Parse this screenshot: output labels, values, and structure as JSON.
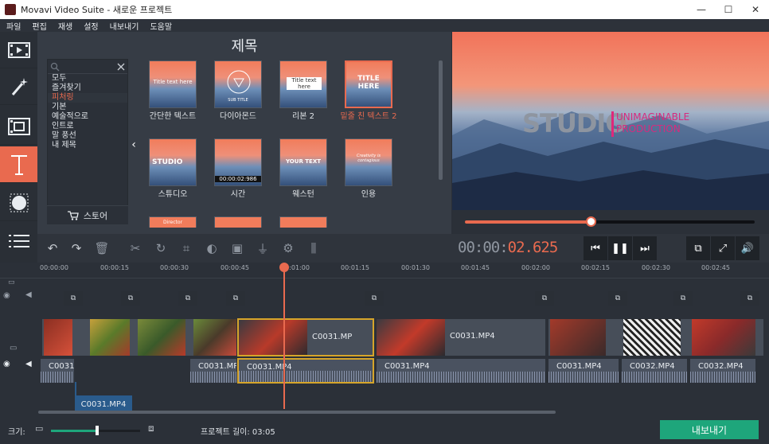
{
  "window": {
    "title": "Movavi Video Suite - 새로운 프로젝트",
    "minimize": "—",
    "maximize": "☐",
    "close": "✕"
  },
  "menu": [
    "파일",
    "편집",
    "재생",
    "설정",
    "내보내기",
    "도움말"
  ],
  "panel": {
    "title": "제목",
    "categories": [
      "모두",
      "즐겨찾기",
      "피처링",
      "기본",
      "예술적으로",
      "인트로",
      "말 풍선",
      "내 제목"
    ],
    "selected_category": "피처링",
    "store_label": "스토어",
    "tiles": [
      {
        "label": "간단한 텍스트",
        "preview": "Title text here"
      },
      {
        "label": "다이아몬드",
        "preview": "SUB TITLE"
      },
      {
        "label": "리본 2",
        "preview": "Title text here"
      },
      {
        "label": "밑줄 친 텍스트 2",
        "preview": "TITLE HERE"
      },
      {
        "label": "스튜디오",
        "preview": "STUDIO"
      },
      {
        "label": "시간",
        "preview": "00:00:02:986"
      },
      {
        "label": "웨스턴",
        "preview": "YOUR TEXT"
      },
      {
        "label": "인용",
        "preview": "Creativity is contagious"
      },
      {
        "label": "",
        "preview": "Director"
      },
      {
        "label": "",
        "preview": ""
      },
      {
        "label": "",
        "preview": ""
      }
    ]
  },
  "preview": {
    "studio": "STUDIO",
    "line1": "UNIMAGINABLE",
    "line2": "PRODUCTION",
    "progress": 0.435
  },
  "timecode": {
    "dim": "00:00:",
    "bright": "02.625"
  },
  "ruler": [
    "00:00:00",
    "00:00:15",
    "00:00:30",
    "00:00:45",
    "00:01:00",
    "00:01:15",
    "00:01:30",
    "00:01:45",
    "00:02:00",
    "00:02:15",
    "00:02:30",
    "00:02:45"
  ],
  "clips": {
    "video": [
      "C0031.MP",
      "C0031.MP4"
    ],
    "audio": [
      "C0031",
      "C0031.MP",
      "C0031.MP4",
      "C0031.MP4",
      "C0031.MP4",
      "C0032.MP4",
      "C0032.MP4"
    ],
    "sub": "C0031.MP4"
  },
  "status": {
    "size_label": "크기:",
    "project_length": "프로젝트 길이:  03:05",
    "zoom": 0.52,
    "export": "내보내기"
  },
  "colors": {
    "accent": "#e96a4f",
    "export": "#1ea67b",
    "selection": "#d6a52a"
  }
}
